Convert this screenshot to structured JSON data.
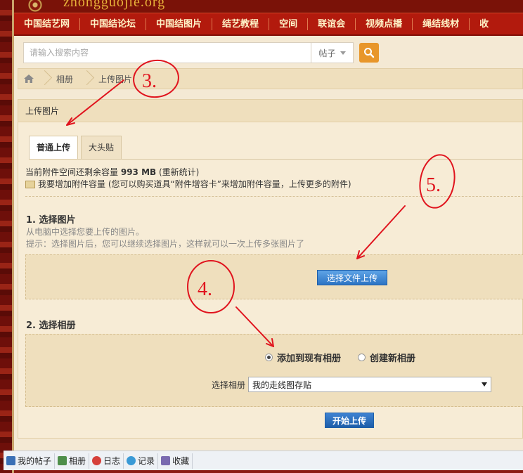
{
  "banner": {
    "site_text": "zhongguojie.org"
  },
  "nav": {
    "items": [
      "中国结艺网",
      "中国结论坛",
      "中国结图片",
      "结艺教程",
      "空间",
      "联谊会",
      "视频点播",
      "绳结线材",
      "收"
    ]
  },
  "search": {
    "placeholder": "请输入搜索内容",
    "type_label": "帖子"
  },
  "breadcrumb": {
    "items": [
      "相册",
      "上传图片"
    ]
  },
  "panel": {
    "title": "上传图片"
  },
  "tabs": [
    {
      "label": "普通上传",
      "active": true
    },
    {
      "label": "大头贴",
      "active": false
    }
  ],
  "quota": {
    "text_prefix": "当前附件空间还剩余容量",
    "amount": "993 MB",
    "recalc": "(重新统计)",
    "increase_note": "我要增加附件容量 (您可以购买道具“附件增容卡”来增加附件容量，上传更多的附件)"
  },
  "section1": {
    "title": "1. 选择图片",
    "hint1": "从电脑中选择您要上传的图片。",
    "hint2": "提示：选择图片后，您可以继续选择图片，这样就可以一次上传多张图片了",
    "choose_button": "选择文件上传"
  },
  "section2": {
    "title": "2. 选择相册",
    "radio_existing": "添加到现有相册",
    "radio_new": "创建新相册",
    "radio_selected": "existing",
    "album_label": "选择相册",
    "album_value": "我的走线图存贴"
  },
  "start_button": "开始上传",
  "bottom_bar": {
    "items": [
      {
        "label": "我的帖子",
        "icon": "post-icon",
        "color": "#3a6fb5"
      },
      {
        "label": "相册",
        "icon": "album-icon",
        "color": "#4f8f4a"
      },
      {
        "label": "日志",
        "icon": "diary-icon",
        "color": "#d6403a"
      },
      {
        "label": "记录",
        "icon": "record-icon",
        "color": "#3a9ad6"
      },
      {
        "label": "收藏",
        "icon": "favorites-icon",
        "color": "#7a6ab0"
      }
    ]
  },
  "annotations": [
    "3.",
    "4.",
    "5."
  ],
  "colors": {
    "nav_bg": "#b21a0d",
    "nav_text": "#fff4c8",
    "search_button": "#e8962a",
    "primary_button": "#2c74c4",
    "annotation": "#e0141e"
  }
}
